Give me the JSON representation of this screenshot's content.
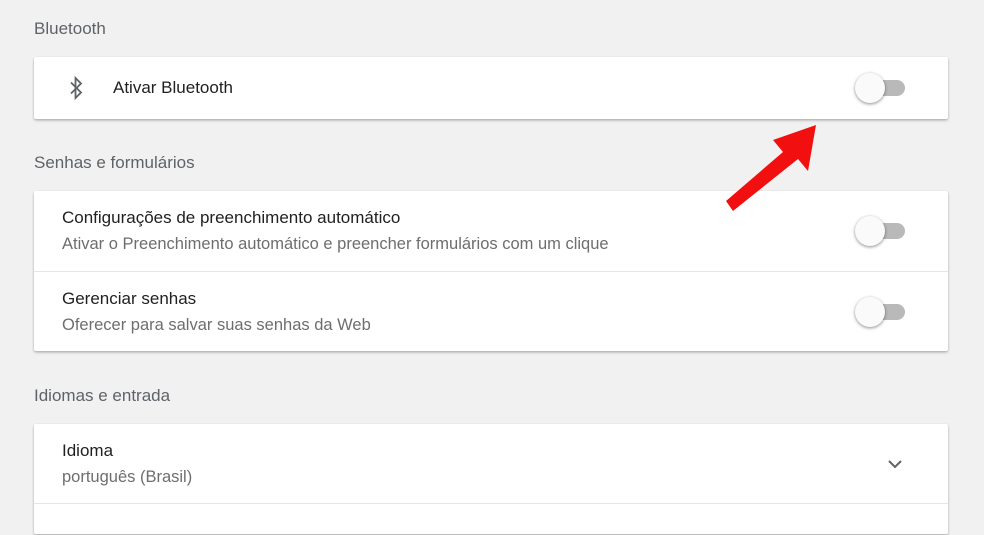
{
  "bluetooth": {
    "section_title": "Bluetooth",
    "icon": "bluetooth-icon",
    "toggle_label": "Ativar Bluetooth",
    "enabled": false
  },
  "passwords": {
    "section_title": "Senhas e formulários",
    "items": [
      {
        "title": "Configurações de preenchimento automático",
        "subtitle": "Ativar o Preenchimento automático e preencher formulários com um clique",
        "enabled": false
      },
      {
        "title": "Gerenciar senhas",
        "subtitle": "Oferecer para salvar suas senhas da Web",
        "enabled": false
      }
    ]
  },
  "languages": {
    "section_title": "Idiomas e entrada",
    "language": {
      "title": "Idioma",
      "value": "português (Brasil)",
      "icon": "chevron-down-icon"
    }
  },
  "annotation": {
    "icon": "red-arrow-icon",
    "color": "#f20f0f"
  },
  "colors": {
    "background": "#f1f1f1",
    "card": "#ffffff",
    "toggle_off_track": "#b9b9b9",
    "toggle_off_knob": "#fafafa"
  }
}
